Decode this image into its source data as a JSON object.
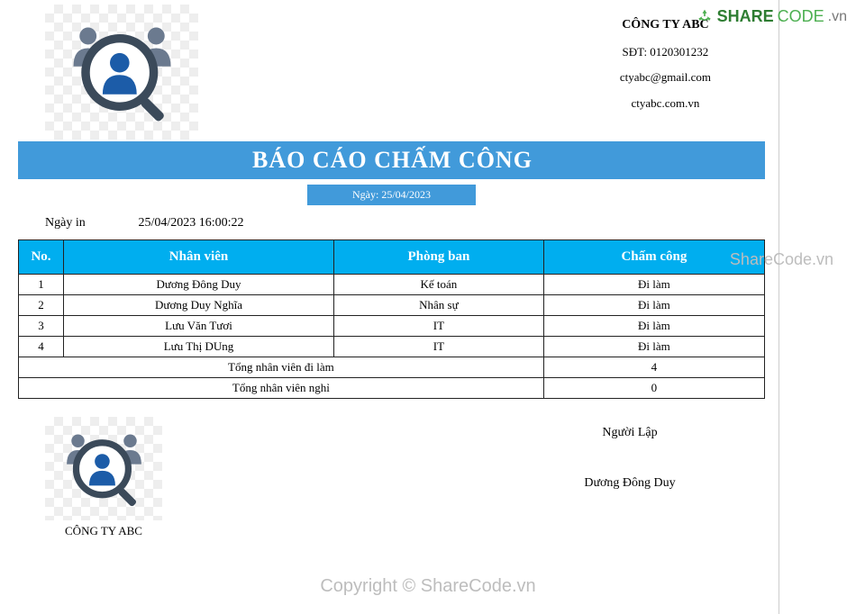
{
  "company": {
    "name": "CÔNG TY ABC",
    "phone_label": "SĐT: 0120301232",
    "email": "ctyabc@gmail.com",
    "website": "ctyabc.com.vn"
  },
  "report": {
    "title": "BÁO CÁO CHẤM CÔNG",
    "date_label": "Ngày: 25/04/2023",
    "print_label": "Ngày in",
    "print_datetime": "25/04/2023 16:00:22"
  },
  "table": {
    "headers": {
      "no": "No.",
      "employee": "Nhân viên",
      "department": "Phòng ban",
      "attendance": "Chấm công"
    },
    "rows": [
      {
        "no": "1",
        "employee": "Dương Đông Duy",
        "department": "Kế toán",
        "attendance": "Đi làm"
      },
      {
        "no": "2",
        "employee": "Dương Duy Nghĩa",
        "department": "Nhân sự",
        "attendance": "Đi làm"
      },
      {
        "no": "3",
        "employee": "Lưu Văn Tươi",
        "department": "IT",
        "attendance": "Đi làm"
      },
      {
        "no": "4",
        "employee": "Lưu Thị DUng",
        "department": "IT",
        "attendance": "Đi làm"
      }
    ],
    "summary": [
      {
        "label": "Tổng nhân viên đi làm",
        "value": "4"
      },
      {
        "label": "Tổng nhân viên nghỉ",
        "value": "0"
      }
    ]
  },
  "footer": {
    "company": "CÔNG TY ABC",
    "role": "Người Lập",
    "preparer": "Dương Đông Duy"
  },
  "watermarks": {
    "center": "Copyright © ShareCode.vn",
    "side": "ShareCode.vn",
    "logo_share": "SHARE",
    "logo_code": "CODE",
    "logo_vn": ".vn"
  }
}
